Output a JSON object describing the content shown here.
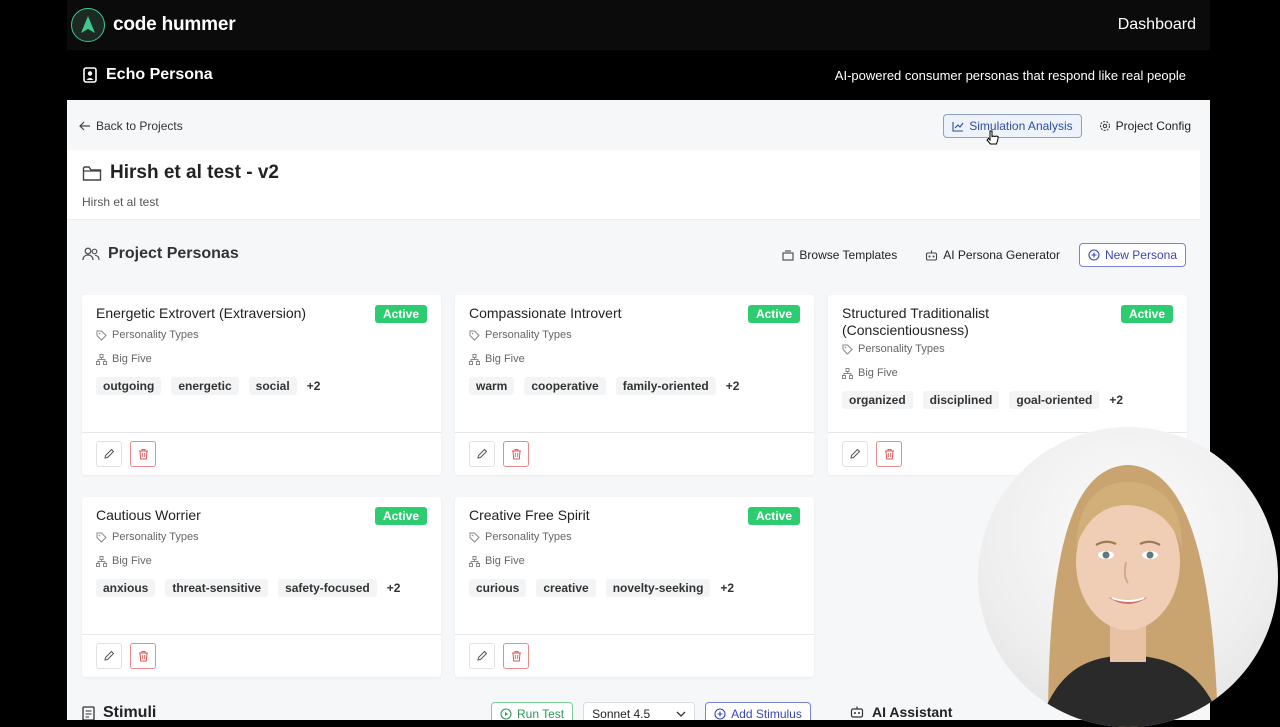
{
  "brand": {
    "name": "code hummer"
  },
  "topnav": {
    "dashboard": "Dashboard"
  },
  "app": {
    "title": "Echo Persona",
    "tagline": "AI-powered consumer personas that respond like real people"
  },
  "nav": {
    "back": "Back to Projects",
    "simulation": "Simulation Analysis",
    "config": "Project Config"
  },
  "project": {
    "title": "Hirsh et al test - v2",
    "subtitle": "Hirsh et al test"
  },
  "personas_section": {
    "title": "Project Personas",
    "browse": "Browse Templates",
    "generator": "AI Persona Generator",
    "new": "New Persona"
  },
  "personas": [
    {
      "name": "Energetic Extrovert (Extraversion)",
      "status": "Active",
      "category": "Personality Types",
      "framework": "Big Five",
      "tags": [
        "outgoing",
        "energetic",
        "social"
      ],
      "more": "+2"
    },
    {
      "name": "Compassionate Introvert",
      "status": "Active",
      "category": "Personality Types",
      "framework": "Big Five",
      "tags": [
        "warm",
        "cooperative",
        "family-oriented"
      ],
      "more": "+2"
    },
    {
      "name": "Structured Traditionalist (Conscientiousness)",
      "status": "Active",
      "category": "Personality Types",
      "framework": "Big Five",
      "tags": [
        "organized",
        "disciplined",
        "goal-oriented"
      ],
      "more": "+2"
    },
    {
      "name": "Cautious Worrier",
      "status": "Active",
      "category": "Personality Types",
      "framework": "Big Five",
      "tags": [
        "anxious",
        "threat-sensitive",
        "safety-focused"
      ],
      "more": "+2"
    },
    {
      "name": "Creative Free Spirit",
      "status": "Active",
      "category": "Personality Types",
      "framework": "Big Five",
      "tags": [
        "curious",
        "creative",
        "novelty-seeking"
      ],
      "more": "+2"
    }
  ],
  "stimuli": {
    "title": "Stimuli",
    "run": "Run Test",
    "model": "Sonnet 4.5",
    "add": "Add Stimulus"
  },
  "assistant": {
    "title": "AI Assistant"
  },
  "colors": {
    "active": "#2ecc71",
    "accent": "#3b45b5",
    "danger": "#e05656"
  }
}
